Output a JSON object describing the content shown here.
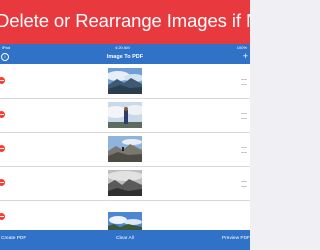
{
  "banner": {
    "text": "Delete or Rearrange Images if Needed"
  },
  "status_bar": {
    "carrier": "iPad",
    "time": "4:20 AM",
    "battery": "100%"
  },
  "nav": {
    "title": "Image To PDF",
    "info_icon": "info-icon",
    "add_icon": "plus-icon"
  },
  "images": [
    {
      "description": "mountain ridge under cloudy blue sky"
    },
    {
      "description": "person standing in front of clouds"
    },
    {
      "description": "rocky summit with hikers"
    },
    {
      "description": "black and white mountain landscape"
    },
    {
      "description": "blue sky with clouds over trees"
    }
  ],
  "toolbar": {
    "create_pdf": "Create PDF",
    "clear_all": "Clear All",
    "preview_pdf": "Preview PDF"
  },
  "colors": {
    "banner": "#e8393f",
    "bars": "#2f72c7",
    "delete": "#ff3b30"
  }
}
